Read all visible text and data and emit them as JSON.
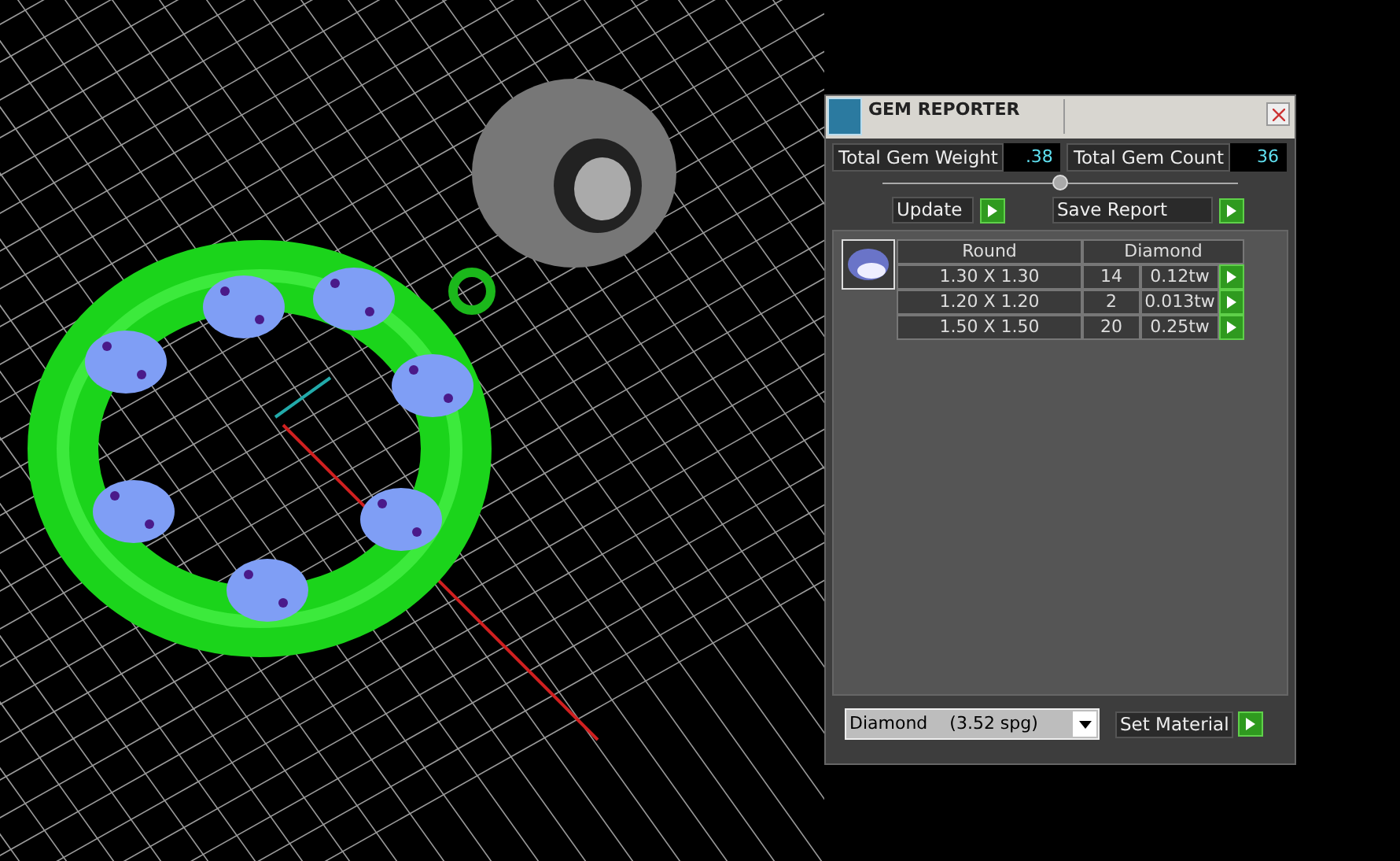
{
  "window": {
    "title": "GEM REPORTER"
  },
  "totals": [
    {
      "label": "Total Gem Weight",
      "value": ".38"
    },
    {
      "label": "Total Gem Count",
      "value": "36"
    }
  ],
  "buttons": [
    {
      "label": "Update"
    },
    {
      "label": "Save Report"
    }
  ],
  "table": {
    "columns": [
      "Round",
      "Diamond"
    ],
    "rows": [
      {
        "size": "1.30 X 1.30",
        "count": "14",
        "weight": "0.12tw"
      },
      {
        "size": "1.20 X 1.20",
        "count": "2",
        "weight": "0.013tw"
      },
      {
        "size": "1.50 X 1.50",
        "count": "20",
        "weight": "0.25tw"
      }
    ]
  },
  "material": {
    "value": "Diamond    (3.52 spg)",
    "button": "Set Material"
  }
}
